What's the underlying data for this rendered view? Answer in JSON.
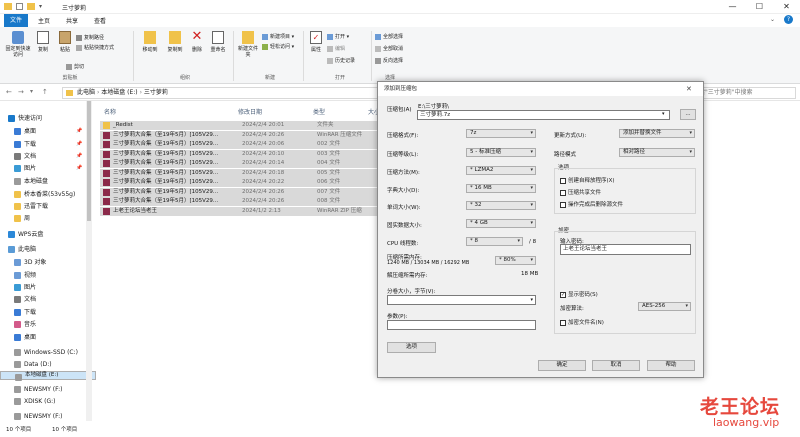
{
  "window": {
    "title": "三寸萝莉",
    "min": "—",
    "max": "☐",
    "close": "✕"
  },
  "menu": {
    "file": "文件",
    "home": "主页",
    "share": "共享",
    "view": "查看"
  },
  "ribbon": {
    "clipboard": {
      "pin": "固定到快速访问",
      "copy": "复制",
      "paste": "粘贴",
      "cut": "剪切",
      "copy_path": "复制路径",
      "paste_shortcut": "粘贴快捷方式",
      "group": "剪贴板"
    },
    "organize": {
      "move_to": "移动到",
      "copy_to": "复制到",
      "delete": "删除",
      "rename": "重命名",
      "group": "组织"
    },
    "new": {
      "new_folder": "新建文件夹",
      "new_item": "新建项目",
      "easy_access": "轻松访问",
      "group": "新建"
    },
    "open": {
      "properties": "属性",
      "open": "打开",
      "edit": "编辑",
      "history": "历史记录",
      "group": "打开"
    },
    "select": {
      "select_all": "全部选择",
      "select_none": "全部取消",
      "invert": "反向选择",
      "group": "选择"
    }
  },
  "address": {
    "path": [
      "此电脑",
      "本地磁盘 (E:)",
      "三寸萝莉"
    ],
    "search_placeholder": "搜索\"三寸萝莉\"中搜索"
  },
  "sidebar": {
    "items": [
      {
        "label": "快速访问",
        "pinned": false
      },
      {
        "label": "桌面",
        "pinned": true
      },
      {
        "label": "下载",
        "pinned": true
      },
      {
        "label": "文档",
        "pinned": true
      },
      {
        "label": "图片",
        "pinned": true
      },
      {
        "label": "本地磁盘",
        "pinned": false
      },
      {
        "label": "桥本香菜(53v55g)",
        "pinned": false
      },
      {
        "label": "迅雷下载",
        "pinned": false
      },
      {
        "label": "周",
        "pinned": false
      },
      {
        "label": "WPS云盘",
        "pinned": false
      },
      {
        "label": "此电脑",
        "pinned": false
      },
      {
        "label": "3D 对象",
        "pinned": false
      },
      {
        "label": "视频",
        "pinned": false
      },
      {
        "label": "图片",
        "pinned": false
      },
      {
        "label": "文档",
        "pinned": false
      },
      {
        "label": "下载",
        "pinned": false
      },
      {
        "label": "音乐",
        "pinned": false
      },
      {
        "label": "桌面",
        "pinned": false
      },
      {
        "label": "Windows-SSD (C:)",
        "pinned": false
      },
      {
        "label": "Data (D:)",
        "pinned": false
      },
      {
        "label": "本地磁盘 (E:)",
        "pinned": false
      },
      {
        "label": "NEWSMY (F:)",
        "pinned": false
      },
      {
        "label": "XDISK (G:)",
        "pinned": false
      },
      {
        "label": "NEWSMY (F:)",
        "pinned": false
      }
    ]
  },
  "files": {
    "headers": {
      "name": "名称",
      "date": "修改日期",
      "type": "类型",
      "size": "大小"
    },
    "rows": [
      {
        "name": "_Redist",
        "date": "2024/2/4 20:01",
        "type": "文件夹",
        "size": ""
      },
      {
        "name": "三寸萝莉大合集（至19年5月）[105V29...",
        "date": "2024/2/4 20:26",
        "type": "WinRAR 压缩文件",
        "size": ""
      },
      {
        "name": "三寸萝莉大合集（至19年5月）[105V29...",
        "date": "2024/2/4 20:06",
        "type": "002 文件",
        "size": ""
      },
      {
        "name": "三寸萝莉大合集（至19年5月）[105V29...",
        "date": "2024/2/4 20:10",
        "type": "003 文件",
        "size": ""
      },
      {
        "name": "三寸萝莉大合集（至19年5月）[105V29...",
        "date": "2024/2/4 20:14",
        "type": "004 文件",
        "size": ""
      },
      {
        "name": "三寸萝莉大合集（至19年5月）[105V29...",
        "date": "2024/2/4 20:18",
        "type": "005 文件",
        "size": ""
      },
      {
        "name": "三寸萝莉大合集（至19年5月）[105V29...",
        "date": "2024/2/4 20:22",
        "type": "006 文件",
        "size": ""
      },
      {
        "name": "三寸萝莉大合集（至19年5月）[105V29...",
        "date": "2024/2/4 20:26",
        "type": "007 文件",
        "size": ""
      },
      {
        "name": "三寸萝莉大合集（至19年5月）[105V29...",
        "date": "2024/2/4 20:26",
        "type": "008 文件",
        "size": ""
      },
      {
        "name": "上老王论坛当老王",
        "date": "2024/1/2 2:13",
        "type": "WinRAR ZIP 压缩",
        "size": ""
      }
    ]
  },
  "status": {
    "count": "10 个项目",
    "selected": "10 个项目"
  },
  "dialog": {
    "title": "添加到压缩包",
    "archive_label": "压缩包(A)",
    "archive_path": "E:\\三寸萝莉\\",
    "archive_name": "三寸萝莉.7z",
    "browse": "...",
    "format_label": "压缩格式(F):",
    "format": "7z",
    "level_label": "压缩等级(L):",
    "level": "5 - 标准压缩",
    "method_label": "压缩方法(M):",
    "method": "* LZMA2",
    "dict_label": "字典大小(D):",
    "dict": "* 16 MB",
    "word_label": "单词大小(W):",
    "word": "* 32",
    "solid_label": "固实数据大小:",
    "solid": "* 4 GB",
    "cpu_label": "CPU 线程数:",
    "cpu": "* 8",
    "cpu_max": "/ 8",
    "mem_label": "压缩所需内存:",
    "mem_value": "1240 MB / 13034 MB / 16292 MB",
    "mem_pct": "* 80%",
    "dmem_label": "解压缩所需内存:",
    "dmem_value": "18 MB",
    "split_label": "分卷大小，字节(V):",
    "params_label": "参数(P):",
    "options_btn": "选项",
    "update_label": "更新方式(U):",
    "update": "添加并替换文件",
    "path_label": "路径模式",
    "path": "相对路径",
    "options_title": "选项",
    "opt_sfx": "创建自释放程序(X)",
    "opt_shared": "压缩共享文件",
    "opt_delete": "操作完成后删除源文件",
    "enc_title": "加密",
    "pwd_label": "输入密码:",
    "pwd_value": "上老王论坛当老王",
    "show_pwd": "显示密码(S)",
    "enc_method_label": "加密算法:",
    "enc_method": "AES-256",
    "enc_names": "加密文件名(N)",
    "ok": "确定",
    "cancel": "取消",
    "help": "帮助"
  },
  "watermark": {
    "cn": "老王论坛",
    "en": "laowang.vip"
  },
  "colors": {
    "accent": "#1979ca",
    "selection": "#cce4f7",
    "watermark": "#e6483d"
  }
}
